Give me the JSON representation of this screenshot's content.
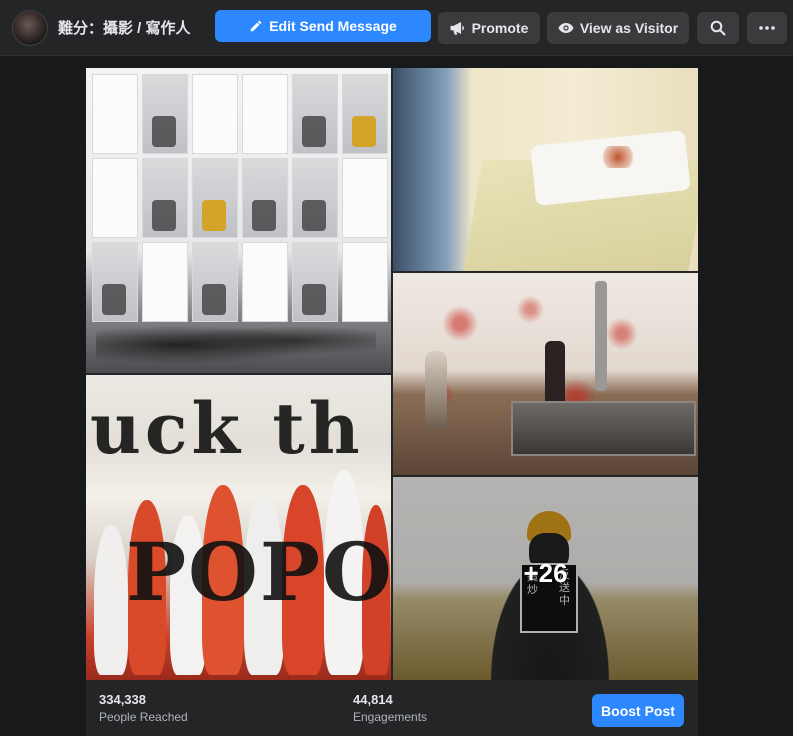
{
  "header": {
    "page_name": "難分：攝影 / 寫作人",
    "buttons": {
      "edit_send_message": "Edit Send Message",
      "promote": "Promote",
      "view_as_visitor": "View as Visitor"
    },
    "icons": {
      "edit": "pencil-icon",
      "promote": "megaphone-icon",
      "visitor": "eye-icon",
      "search": "search-icon",
      "more": "more-dots-icon"
    }
  },
  "post": {
    "photos": [
      {
        "subject": "lockers"
      },
      {
        "subject": "bed"
      },
      {
        "subject": "sink"
      },
      {
        "subject": "group-poster",
        "graffiti_top": "uck th",
        "graffiti_bottom": "POPO"
      },
      {
        "subject": "gas-mask",
        "sign_left": "攬炒",
        "sign_right": "反送中"
      }
    ],
    "more_count": "+26"
  },
  "stats": {
    "people_reached": {
      "value": "334,338",
      "label": "People Reached"
    },
    "engagements": {
      "value": "44,814",
      "label": "Engagements"
    },
    "boost_label": "Boost Post"
  },
  "colors": {
    "primary": "#2d88ff",
    "background": "#18191a",
    "surface": "#242526",
    "button": "#3a3b3c"
  }
}
